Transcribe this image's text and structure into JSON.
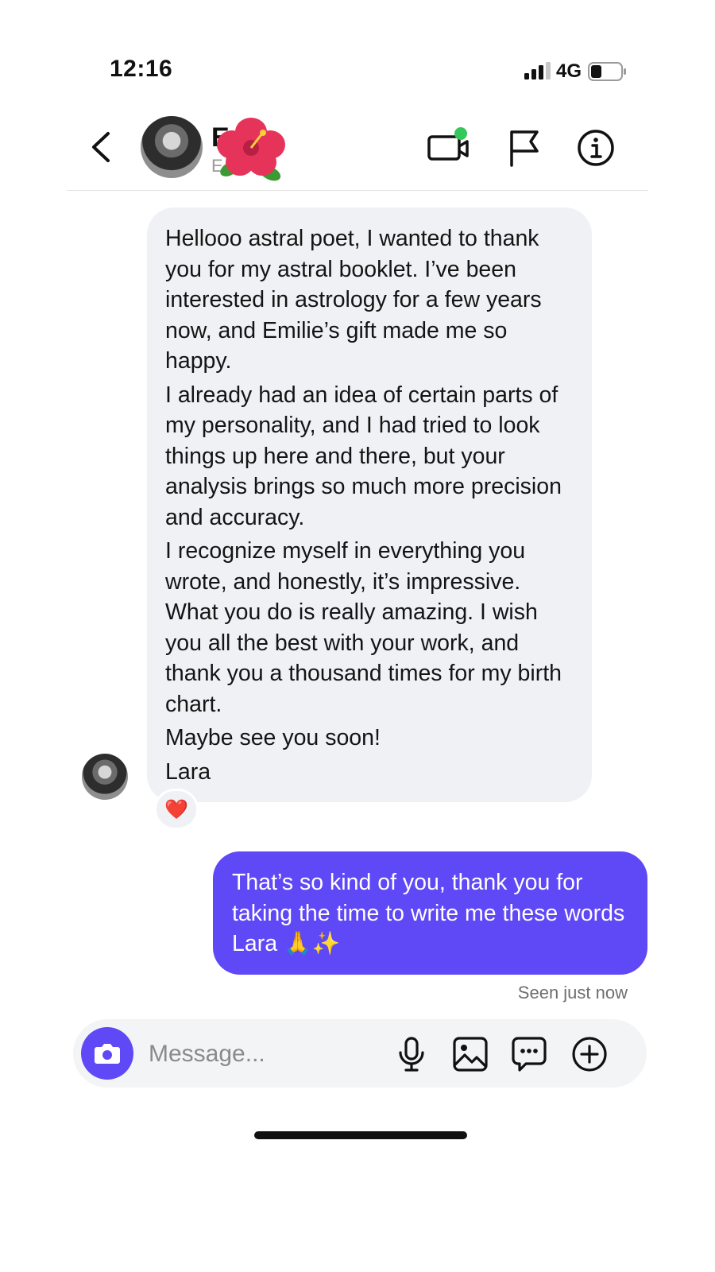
{
  "status_bar": {
    "time": "12:16",
    "network": "4G"
  },
  "header": {
    "contact_name": "E",
    "contact_subtitle": "E",
    "icons": [
      "back-icon",
      "video-call-icon",
      "flag-icon",
      "info-icon"
    ],
    "online_dot_color": "#34c759"
  },
  "messages": {
    "incoming": {
      "paragraphs": [
        "Hellooo astral poet, I wanted to thank you for my astral booklet. I’ve been interested in astrology for a few years now, and Emilie’s gift made me so happy.",
        "I already had an idea of certain parts of my personality, and I had tried to look things up here and there, but your analysis brings so much more precision and accuracy.",
        "I recognize myself in everything you wrote, and honestly, it’s impressive. What you do is really amazing. I wish you all the best with your work, and thank you a thousand times for my birth chart.",
        "Maybe see you soon!",
        "Lara"
      ],
      "reaction": "❤️"
    },
    "outgoing": {
      "text": "That’s so kind of you, thank you for taking the time to write me these words Lara 🙏✨"
    },
    "seen_status": "Seen just now"
  },
  "composer": {
    "placeholder": "Message...",
    "icons": [
      "camera-icon",
      "microphone-icon",
      "image-icon",
      "sticker-chat-icon",
      "plus-circle-icon"
    ]
  },
  "colors": {
    "accent": "#5f48f5",
    "incoming_bubble": "#eff1f4",
    "reaction_heart": "#e0243a"
  }
}
